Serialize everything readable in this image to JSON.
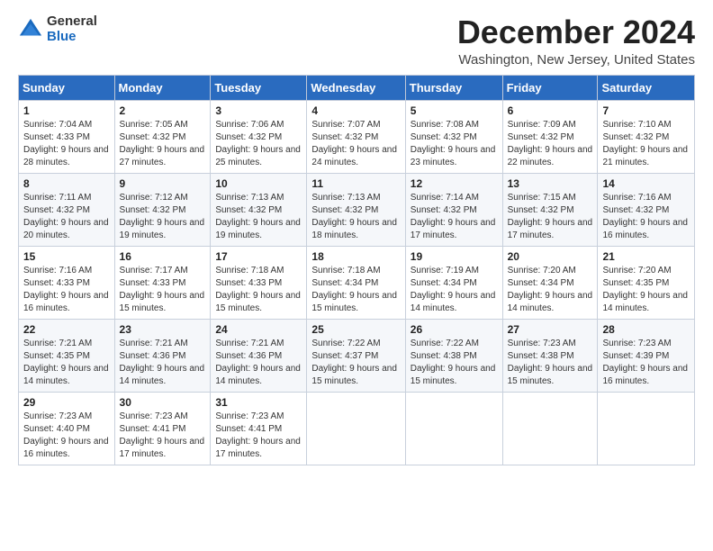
{
  "logo": {
    "general": "General",
    "blue": "Blue"
  },
  "title": "December 2024",
  "location": "Washington, New Jersey, United States",
  "headers": [
    "Sunday",
    "Monday",
    "Tuesday",
    "Wednesday",
    "Thursday",
    "Friday",
    "Saturday"
  ],
  "weeks": [
    [
      {
        "day": "1",
        "sunrise": "7:04 AM",
        "sunset": "4:33 PM",
        "daylight": "9 hours and 28 minutes."
      },
      {
        "day": "2",
        "sunrise": "7:05 AM",
        "sunset": "4:32 PM",
        "daylight": "9 hours and 27 minutes."
      },
      {
        "day": "3",
        "sunrise": "7:06 AM",
        "sunset": "4:32 PM",
        "daylight": "9 hours and 25 minutes."
      },
      {
        "day": "4",
        "sunrise": "7:07 AM",
        "sunset": "4:32 PM",
        "daylight": "9 hours and 24 minutes."
      },
      {
        "day": "5",
        "sunrise": "7:08 AM",
        "sunset": "4:32 PM",
        "daylight": "9 hours and 23 minutes."
      },
      {
        "day": "6",
        "sunrise": "7:09 AM",
        "sunset": "4:32 PM",
        "daylight": "9 hours and 22 minutes."
      },
      {
        "day": "7",
        "sunrise": "7:10 AM",
        "sunset": "4:32 PM",
        "daylight": "9 hours and 21 minutes."
      }
    ],
    [
      {
        "day": "8",
        "sunrise": "7:11 AM",
        "sunset": "4:32 PM",
        "daylight": "9 hours and 20 minutes."
      },
      {
        "day": "9",
        "sunrise": "7:12 AM",
        "sunset": "4:32 PM",
        "daylight": "9 hours and 19 minutes."
      },
      {
        "day": "10",
        "sunrise": "7:13 AM",
        "sunset": "4:32 PM",
        "daylight": "9 hours and 19 minutes."
      },
      {
        "day": "11",
        "sunrise": "7:13 AM",
        "sunset": "4:32 PM",
        "daylight": "9 hours and 18 minutes."
      },
      {
        "day": "12",
        "sunrise": "7:14 AM",
        "sunset": "4:32 PM",
        "daylight": "9 hours and 17 minutes."
      },
      {
        "day": "13",
        "sunrise": "7:15 AM",
        "sunset": "4:32 PM",
        "daylight": "9 hours and 17 minutes."
      },
      {
        "day": "14",
        "sunrise": "7:16 AM",
        "sunset": "4:32 PM",
        "daylight": "9 hours and 16 minutes."
      }
    ],
    [
      {
        "day": "15",
        "sunrise": "7:16 AM",
        "sunset": "4:33 PM",
        "daylight": "9 hours and 16 minutes."
      },
      {
        "day": "16",
        "sunrise": "7:17 AM",
        "sunset": "4:33 PM",
        "daylight": "9 hours and 15 minutes."
      },
      {
        "day": "17",
        "sunrise": "7:18 AM",
        "sunset": "4:33 PM",
        "daylight": "9 hours and 15 minutes."
      },
      {
        "day": "18",
        "sunrise": "7:18 AM",
        "sunset": "4:34 PM",
        "daylight": "9 hours and 15 minutes."
      },
      {
        "day": "19",
        "sunrise": "7:19 AM",
        "sunset": "4:34 PM",
        "daylight": "9 hours and 14 minutes."
      },
      {
        "day": "20",
        "sunrise": "7:20 AM",
        "sunset": "4:34 PM",
        "daylight": "9 hours and 14 minutes."
      },
      {
        "day": "21",
        "sunrise": "7:20 AM",
        "sunset": "4:35 PM",
        "daylight": "9 hours and 14 minutes."
      }
    ],
    [
      {
        "day": "22",
        "sunrise": "7:21 AM",
        "sunset": "4:35 PM",
        "daylight": "9 hours and 14 minutes."
      },
      {
        "day": "23",
        "sunrise": "7:21 AM",
        "sunset": "4:36 PM",
        "daylight": "9 hours and 14 minutes."
      },
      {
        "day": "24",
        "sunrise": "7:21 AM",
        "sunset": "4:36 PM",
        "daylight": "9 hours and 14 minutes."
      },
      {
        "day": "25",
        "sunrise": "7:22 AM",
        "sunset": "4:37 PM",
        "daylight": "9 hours and 15 minutes."
      },
      {
        "day": "26",
        "sunrise": "7:22 AM",
        "sunset": "4:38 PM",
        "daylight": "9 hours and 15 minutes."
      },
      {
        "day": "27",
        "sunrise": "7:23 AM",
        "sunset": "4:38 PM",
        "daylight": "9 hours and 15 minutes."
      },
      {
        "day": "28",
        "sunrise": "7:23 AM",
        "sunset": "4:39 PM",
        "daylight": "9 hours and 16 minutes."
      }
    ],
    [
      {
        "day": "29",
        "sunrise": "7:23 AM",
        "sunset": "4:40 PM",
        "daylight": "9 hours and 16 minutes."
      },
      {
        "day": "30",
        "sunrise": "7:23 AM",
        "sunset": "4:41 PM",
        "daylight": "9 hours and 17 minutes."
      },
      {
        "day": "31",
        "sunrise": "7:23 AM",
        "sunset": "4:41 PM",
        "daylight": "9 hours and 17 minutes."
      },
      null,
      null,
      null,
      null
    ]
  ],
  "labels": {
    "sunrise": "Sunrise:",
    "sunset": "Sunset:",
    "daylight": "Daylight:"
  }
}
